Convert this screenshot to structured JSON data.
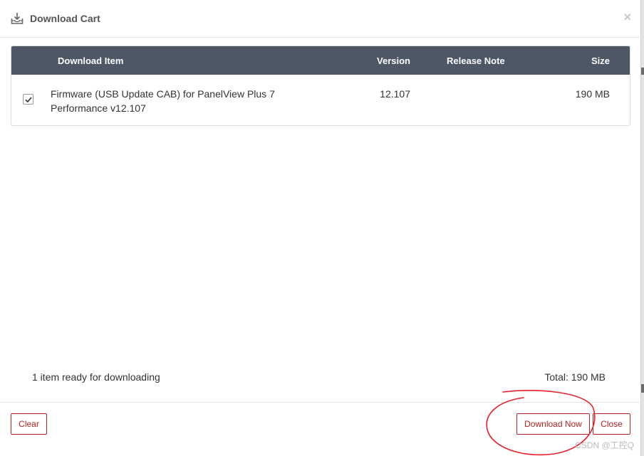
{
  "dialog": {
    "title": "Download Cart",
    "header_icon": "download-tray-icon",
    "close_glyph": "×"
  },
  "table": {
    "columns": {
      "item": "Download Item",
      "version": "Version",
      "release_note": "Release Note",
      "size": "Size"
    },
    "rows": [
      {
        "checked": true,
        "name": "Firmware (USB Update CAB) for PanelView Plus 7 Performance v12.107",
        "version": "12.107",
        "release_note": "",
        "size": "190 MB"
      }
    ]
  },
  "summary": {
    "status": "1 item ready for downloading",
    "total": "Total: 190 MB"
  },
  "footer": {
    "clear_label": "Clear",
    "download_label": "Download Now",
    "close_label": "Close"
  },
  "colors": {
    "header_bg": "#4d5766",
    "button_accent": "#b22222",
    "annotation": "#e8202a"
  },
  "watermark": "CSDN @工控Q"
}
